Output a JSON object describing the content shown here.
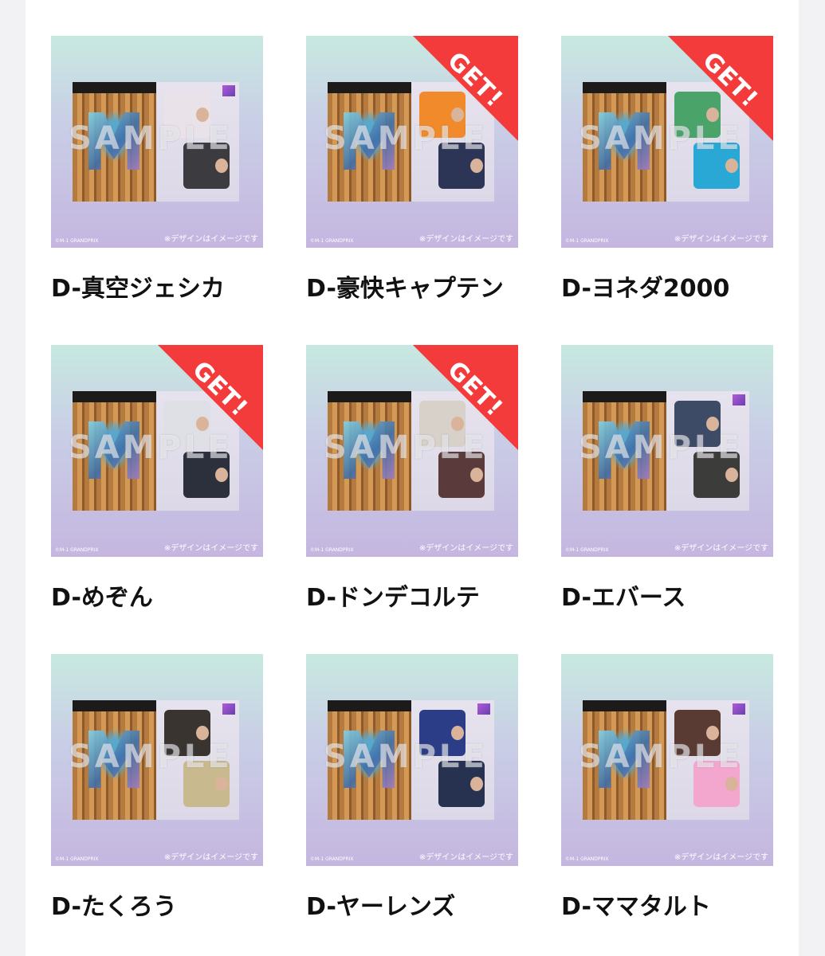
{
  "sample_watermark": "SAMPLE",
  "copyright": "©M-1 GRANDPRIX",
  "disclaimer": "※デザインはイメージです",
  "badge_text": "GET!",
  "colors": {
    "badge": "#f33b3b",
    "gradient_top": "#c7e9e0",
    "gradient_bottom": "#c5b6e0"
  },
  "items": [
    {
      "label": "D-真空ジェシカ",
      "got": false,
      "outfit": [
        "#e9e3e9",
        "#3b3b40"
      ]
    },
    {
      "label": "D-豪快キャプテン",
      "got": true,
      "outfit": [
        "#f08a2a",
        "#2d3556"
      ]
    },
    {
      "label": "D-ヨネダ2000",
      "got": true,
      "outfit": [
        "#4aa46a",
        "#29a8d6"
      ]
    },
    {
      "label": "D-めぞん",
      "got": true,
      "outfit": [
        "#dfe0e6",
        "#2c2f3c"
      ]
    },
    {
      "label": "D-ドンデコルテ",
      "got": true,
      "outfit": [
        "#d7d1c9",
        "#5a3a3a"
      ]
    },
    {
      "label": "D-エバース",
      "got": false,
      "outfit": [
        "#3e4b66",
        "#3c3c3a"
      ]
    },
    {
      "label": "D-たくろう",
      "got": false,
      "outfit": [
        "#3a3431",
        "#c9b98f"
      ]
    },
    {
      "label": "D-ヤーレンズ",
      "got": false,
      "outfit": [
        "#2b3d86",
        "#26324f"
      ]
    },
    {
      "label": "D-ママタルト",
      "got": false,
      "outfit": [
        "#5a3b33",
        "#f3a7cf"
      ]
    }
  ]
}
